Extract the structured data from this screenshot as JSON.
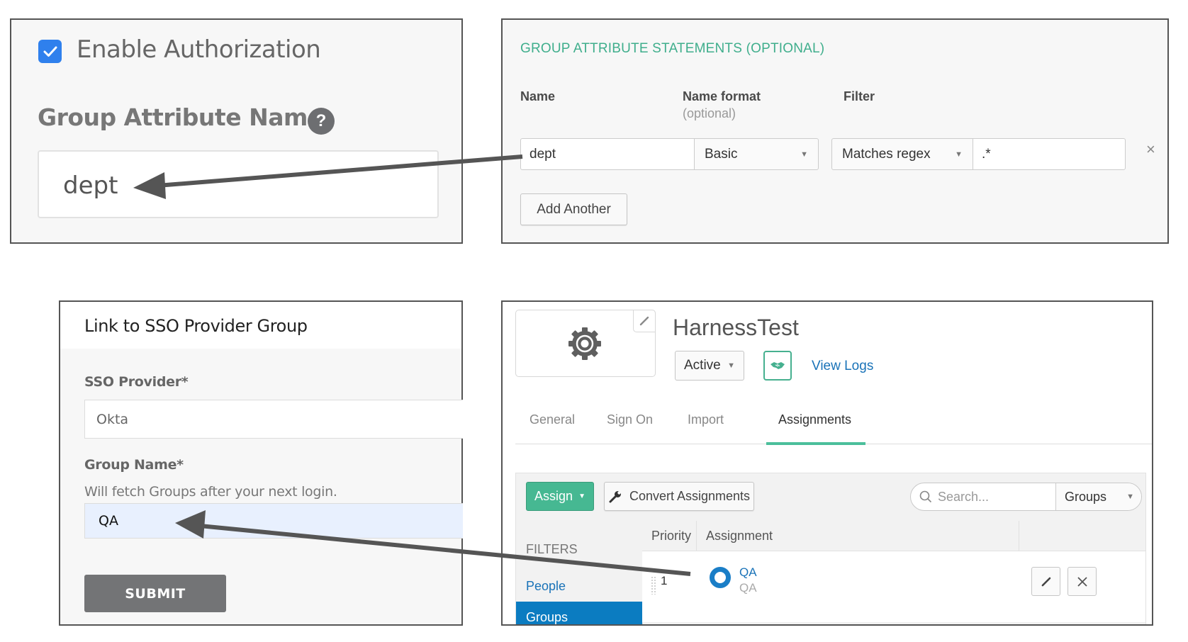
{
  "authorization_panel": {
    "enable_checkbox_checked": true,
    "enable_label": "Enable Authorization",
    "group_attribute_label": "Group Attribute Name",
    "help_icon_glyph": "?",
    "group_attribute_value": "dept",
    "checkbox_color": "#2f80ed"
  },
  "group_attribute_statements": {
    "title": "GROUP ATTRIBUTE STATEMENTS (OPTIONAL)",
    "title_color": "#3fae8c",
    "columns": {
      "name": "Name",
      "name_format": "Name format",
      "name_format_sub": "(optional)",
      "filter": "Filter"
    },
    "row": {
      "name": "dept",
      "name_format": "Basic",
      "filter_type": "Matches regex",
      "filter_value": ".*",
      "remove_glyph": "×"
    },
    "add_another_label": "Add Another"
  },
  "sso_link_panel": {
    "title": "Link to SSO Provider Group",
    "sso_provider_label": "SSO Provider*",
    "sso_provider_value": "Okta",
    "group_name_label": "Group Name*",
    "group_name_hint": "Will fetch Groups after your next login.",
    "group_name_value": "QA",
    "submit_label": "SUBMIT"
  },
  "okta_app_panel": {
    "app_name": "HarnessTest",
    "status": "Active",
    "view_logs_label": "View Logs",
    "tabs": [
      {
        "label": "General",
        "active": false
      },
      {
        "label": "Sign On",
        "active": false
      },
      {
        "label": "Import",
        "active": false
      },
      {
        "label": "Assignments",
        "active": true
      }
    ],
    "assign_label": "Assign",
    "convert_label": "Convert Assignments",
    "search_placeholder": "Search...",
    "search_scope": "Groups",
    "filters_label": "FILTERS",
    "filter_items": [
      {
        "label": "People",
        "selected": false
      },
      {
        "label": "Groups",
        "selected": true
      }
    ],
    "table": {
      "headers": [
        "Priority",
        "Assignment"
      ],
      "rows": [
        {
          "priority": "1",
          "name": "QA",
          "description": "QA"
        }
      ]
    },
    "accent_color": "#46b892",
    "link_color": "#1a73b8",
    "selected_filter_color": "#0b7cc1"
  }
}
